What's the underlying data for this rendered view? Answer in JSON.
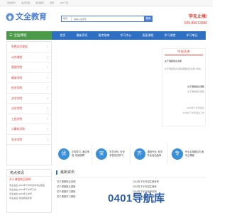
{
  "topbar": {
    "items": [
      "招简新华",
      "会员管理",
      "考试服务",
      "招聘",
      "APP下载"
    ]
  },
  "brand": {
    "name": "文全教育",
    "accent": "#4a7cd6"
  },
  "search": {
    "type": "培训",
    "placeholder": "请输入关键字",
    "button": "搜索"
  },
  "contact": {
    "title": "学无止境!",
    "phone": "029-85012580"
  },
  "nav": {
    "home_label": "全国课程",
    "items": [
      "首页",
      "最新资讯",
      "报考指南",
      "学习中心",
      "班面课程",
      "学习课堂",
      "学习笔记"
    ]
  },
  "sidebar": {
    "items": [
      "免费试学课程",
      "公共课程",
      "管理学院",
      "教育学院",
      "经济学院",
      "文学学院",
      "法学学院",
      "工程学院",
      "计算机学院",
      "农业学院"
    ]
  },
  "today": {
    "title": "今日头条",
    "items": [
      {
        "title": "关于课程购买说明",
        "sub": "关于课程购买说明|课程购买说明 [详情]"
      },
      {
        "title": "关于课程报名课程",
        "sub": "关于课程报名课程"
      },
      {
        "title": "2018年下半年招生",
        "sub": "2018年下半年招生工作"
      }
    ]
  },
  "features": [
    {
      "icon": "优",
      "line1": "正规学习, 通过率",
      "line2": "高, 权威保障"
    },
    {
      "icon": "安",
      "line1": "学员无忧, 安全",
      "line2": "享受在线学习"
    },
    {
      "icon": "齐",
      "line1": "课程齐全, 班次",
      "line2": "齐全自由选择"
    },
    {
      "icon": "专",
      "line1": "专业名师团队打造",
      "line2": "专业课程"
    }
  ],
  "hot": {
    "title": "热点资讯",
    "first": "关于课程购买说明",
    "items": [
      "专业进出| 2019年下半年自学考试报名",
      "专业进出| 2019年下半年工作",
      "专业进出| 2019年上半年",
      "专业进出| 考试成绩查询"
    ]
  },
  "latest": {
    "title": "最新资讯",
    "left": [
      "关于课程购买说明",
      "关于课程报名课程",
      "关于课程学习课程",
      "关于课程学习课程"
    ],
    "right": [
      "2018年下半年招生报考考",
      "2018年下半年招生报考",
      "2018年下半年报考说明",
      "2018年下半年招生通知"
    ]
  },
  "watermark": "0401导航库"
}
